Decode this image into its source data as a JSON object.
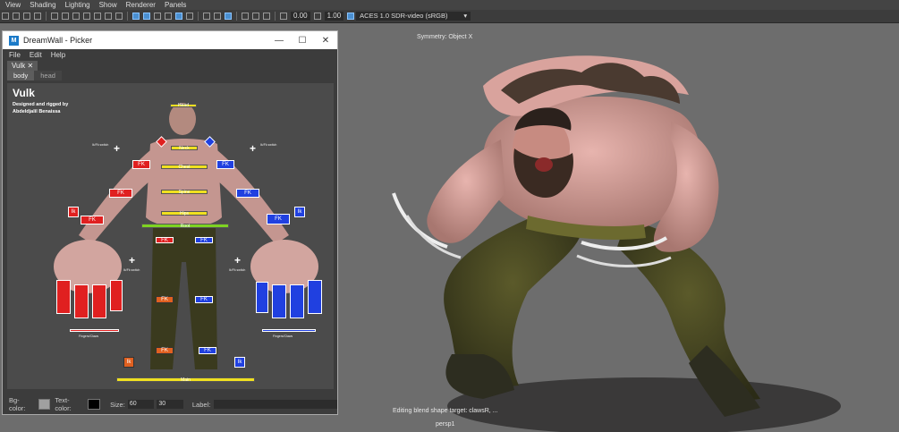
{
  "maya": {
    "menu": [
      "View",
      "Shading",
      "Lighting",
      "Show",
      "Renderer",
      "Panels"
    ],
    "toolbar": {
      "exposure": "0.00",
      "gamma": "1.00",
      "colorspace": "ACES 1.0 SDR-video (sRGB)"
    }
  },
  "viewport": {
    "symmetry": "Symmetry: Object X",
    "status": "Editing blend shape target: clawsR, ...",
    "camera": "persp1"
  },
  "picker": {
    "title": "DreamWall - Picker",
    "menu": [
      "File",
      "Edit",
      "Help"
    ],
    "tab": "Vulk",
    "close_glyph": "✕",
    "subtabs": [
      "body",
      "head"
    ],
    "character_name": "Vulk",
    "credit_line1": "Designed and rigged by",
    "credit_line2": "Abdeldjalil Benaissa",
    "labels": {
      "ikfk_switch_l": "Ik/Fk switch",
      "ikfk_switch_r": "Ik/Fk switch",
      "fk": "FK",
      "ik": "Ik",
      "ikfk_leg_l": "Ik/Fk switch",
      "ikfk_leg_r": "Ik/Fk switch",
      "fingers_l": "Fingers/Claws",
      "fingers_r": "Fingers/Claws",
      "main": "Main",
      "head": "Head",
      "neck": "Neck",
      "chest": "Chest",
      "spine": "Spine",
      "hips": "Hips",
      "root": "Root"
    },
    "footer": {
      "bg_label": "Bg-color:",
      "text_label": "Text-color:",
      "size_label": "Size:",
      "size_w": "60",
      "size_h": "30",
      "label_label": "Label:"
    },
    "colors": {
      "bg_swatch": "#a0a0a0",
      "text_swatch": "#000000"
    }
  }
}
